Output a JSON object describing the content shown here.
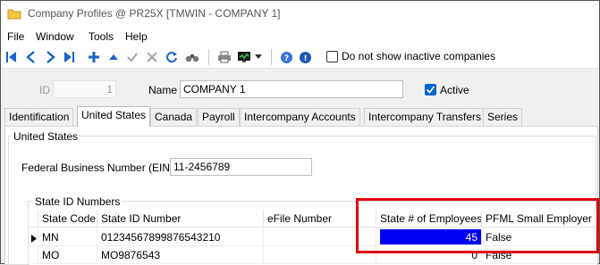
{
  "window": {
    "title": "Company Profiles @ PR25X [TMWIN - COMPANY 1]",
    "icon": "folder-icon"
  },
  "menu": [
    "File",
    "Window",
    "Tools",
    "Help"
  ],
  "toolbar": {
    "checkbox_label": "Do not show inactive companies",
    "checkbox_checked": false
  },
  "form": {
    "id_label": "ID",
    "id_value": "1",
    "name_label": "Name",
    "name_value": "COMPANY 1",
    "active_label": "Active",
    "active_checked": true
  },
  "tabs": [
    "Identification",
    "United States",
    "Canada",
    "Payroll",
    "Intercompany Accounts",
    "Intercompany Transfers",
    "Series"
  ],
  "active_tab": "United States",
  "panel": {
    "group_title": "United States",
    "ein_label": "Federal Business Number (EIN)",
    "ein_value": "11-2456789",
    "state_group_title": "State ID Numbers"
  },
  "grid": {
    "columns": [
      "State Code",
      "State ID Number",
      "eFile Number",
      "State # of Employees",
      "PFML Small Employer"
    ],
    "rows": [
      {
        "state_code": "MN",
        "state_id": "01234567899876543210",
        "efile": "",
        "employees": "45",
        "pfml": "False",
        "current": true
      },
      {
        "state_code": "MO",
        "state_id": "MO9876543",
        "efile": "",
        "employees": "0",
        "pfml": "False",
        "current": false
      }
    ]
  },
  "colors": {
    "highlight": "#e0000e",
    "selection": "#0000f5",
    "accent": "#0066cc"
  }
}
